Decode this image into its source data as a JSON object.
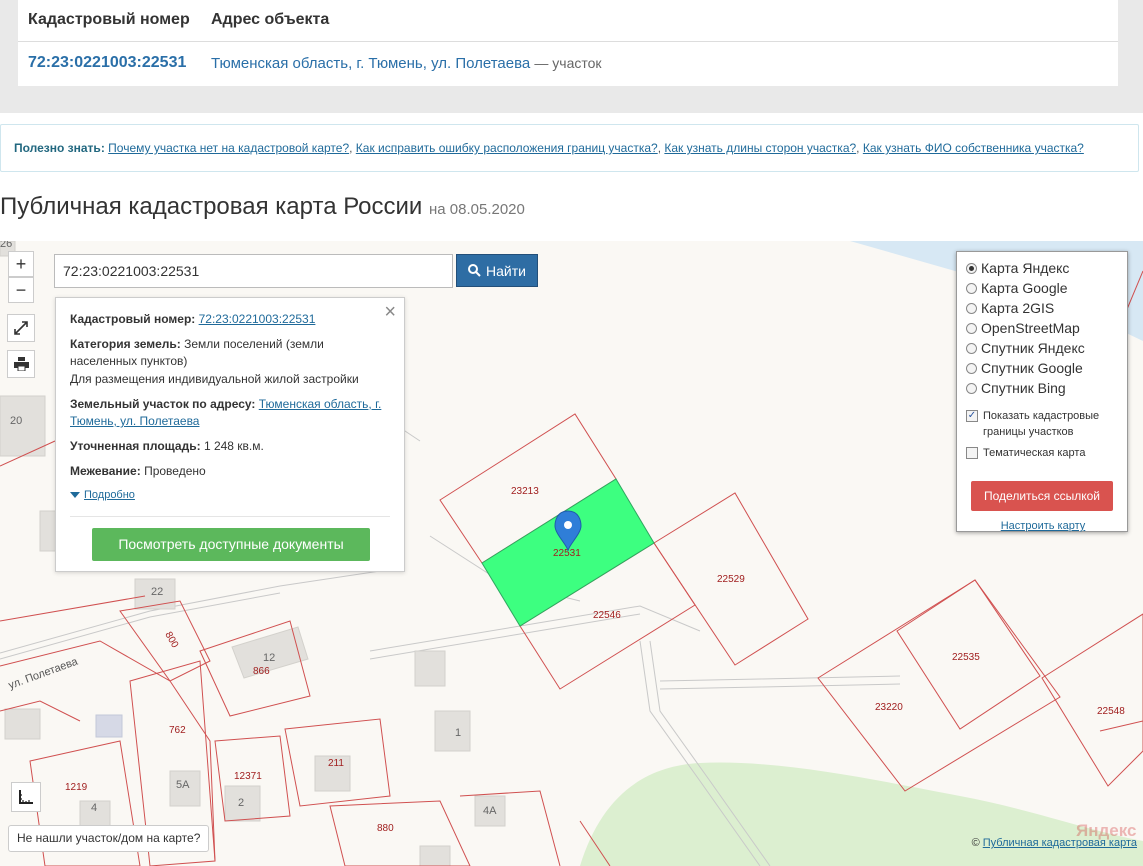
{
  "top_table": {
    "col1": "Кадастровый номер",
    "col2": "Адрес объекта",
    "row": {
      "number": "72:23:0221003:22531",
      "address": "Тюменская область, г. Тюмень, ул. Полетаева",
      "suffix": "— участок"
    }
  },
  "info_bar": {
    "label": "Полезно знать:",
    "links": [
      "Почему участка нет на кадастровой карте?",
      "Как исправить ошибку расположения границ участка?",
      "Как узнать длины сторон участка?",
      "Как узнать ФИО собственника участка?"
    ]
  },
  "heading": {
    "title": "Публичная кадастровая карта России",
    "date": "на 08.05.2020"
  },
  "map": {
    "zoom_in": "+",
    "zoom_out": "−",
    "search_value": "72:23:0221003:22531",
    "find_label": "Найти",
    "popup": {
      "cad_label": "Кадастровый номер:",
      "cad_value": "72:23:0221003:22531",
      "cat_label": "Категория земель:",
      "cat_value": "Земли поселений (земли населенных пунктов)",
      "purpose": "Для размещения индивидуальной жилой застройки",
      "addr_label": "Земельный участок по адресу:",
      "addr_value": "Тюменская область, г. Тюмень, ул. Полетаева",
      "area_label": "Уточненная площадь:",
      "area_value": "1 248 кв.м.",
      "survey_label": "Межевание:",
      "survey_value": "Проведено",
      "more": "Подробно",
      "docs_button": "Посмотреть доступные документы"
    },
    "layers": {
      "options": [
        "Карта Яндекс",
        "Карта Google",
        "Карта 2GIS",
        "OpenStreetMap",
        "Спутник Яндекс",
        "Спутник Google",
        "Спутник Bing"
      ],
      "selected": "Карта Яндекс",
      "show_borders": "Показать кадастровые границы участков",
      "thematic": "Тематическая карта",
      "share_button": "Поделиться ссылкой",
      "configure": "Настроить карту"
    },
    "plots": {
      "p23213": "23213",
      "p22531": "22531",
      "p22529": "22529",
      "p22546": "22546",
      "p22535": "22535",
      "p23220": "23220",
      "p22548": "22548",
      "p800": "800",
      "p866": "866",
      "p762": "762",
      "p1219": "1219",
      "p12371": "12371",
      "p211": "211",
      "p880": "880"
    },
    "houses": {
      "h26": "26",
      "h20": "20",
      "h22": "22",
      "h12": "12",
      "h1": "1",
      "h5a": "5А",
      "h2": "2",
      "h4": "4",
      "h4a": "4А"
    },
    "street": "ул. Полетаева",
    "not_found": "Не нашли участок/дом на карте?",
    "copyright_prefix": "©",
    "copyright_link": "Публичная кадастровая карта",
    "yandex": "Яндекс"
  }
}
